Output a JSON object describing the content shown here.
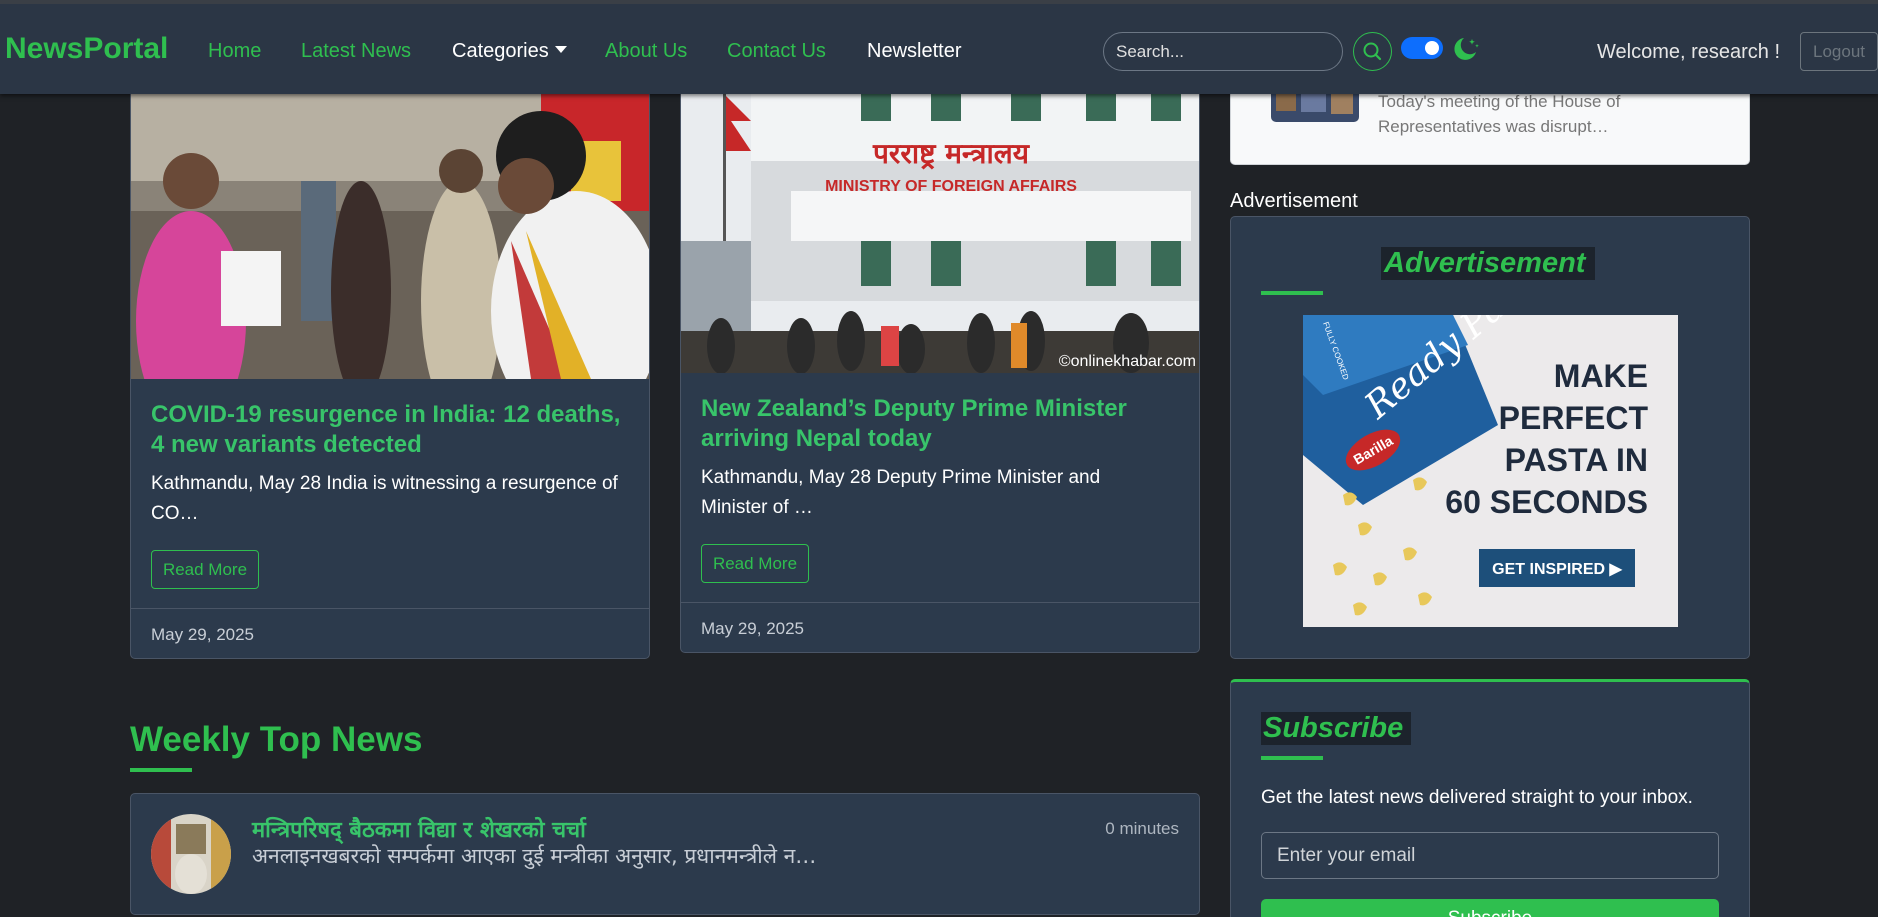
{
  "navbar": {
    "brand": "NewsPortal",
    "links": [
      "Home",
      "Latest News",
      "Categories",
      "About Us",
      "Contact Us",
      "Newsletter"
    ],
    "search_placeholder": "Search...",
    "welcome": "Welcome, research !",
    "logout": "Logout",
    "dark_mode_on": true,
    "accent_color": "#2fbf4f"
  },
  "cards": [
    {
      "title": "COVID-19 resurgence in India: 12 deaths, 4 new variants detected",
      "excerpt": "Kathmandu, May 28 India is witnessing a resurgence of CO…",
      "read_more": "Read More",
      "date": "May 29, 2025"
    },
    {
      "title": "New Zealand’s Deputy Prime Minister arriving Nepal today",
      "excerpt": "Kathmandu, May 28 Deputy Prime Minister and Minister of …",
      "read_more": "Read More",
      "date": "May 29, 2025",
      "image_text": {
        "sign_nepali": "परराष्ट्र मन्त्रालय",
        "sign_english": "MINISTRY OF FOREIGN AFFAIRS",
        "watermark": "©onlinekhabar.com"
      }
    }
  ],
  "weekly": {
    "heading": "Weekly Top News",
    "items": [
      {
        "title": "मन्त्रिपरिषद् बैठकमा विद्या र शेखरको चर्चा",
        "excerpt": "अनलाइनखबरको सम्पर्कमा आएका दुई मन्त्रीका अनुसार, प्रधानमन्त्रीले न…",
        "time": "0 minutes"
      }
    ]
  },
  "sidebar": {
    "top_item_text": "Today's meeting of the House of Representatives was disrupt…",
    "ad_label": "Advertisement",
    "ad_heading": "Advertisement",
    "ad_image": {
      "brand_script": "Ready Pasta",
      "brand_logo": "Barilla",
      "line1": "MAKE",
      "line2": "PERFECT",
      "line3": "PASTA IN",
      "line4": "60 SECONDS",
      "cta": "GET INSPIRED ▶",
      "side_text": "FULLY COOKED"
    },
    "subscribe": {
      "heading": "Subscribe",
      "description": "Get the latest news delivered straight to your inbox.",
      "email_placeholder": "Enter your email",
      "button": "Subscribe"
    }
  }
}
